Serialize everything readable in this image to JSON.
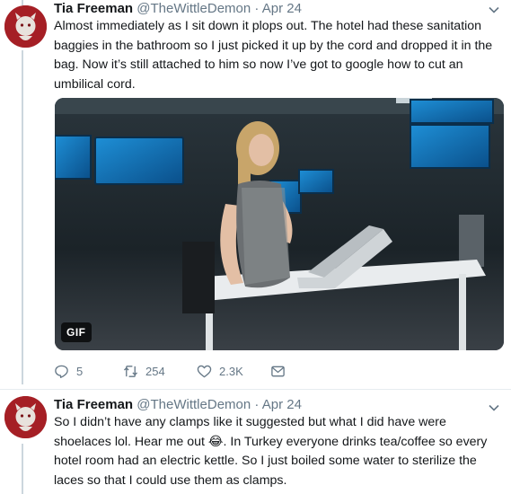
{
  "tweets": [
    {
      "author_name": "Tia Freeman",
      "handle": "@TheWittleDemon",
      "separator": "·",
      "date": "Apr 24",
      "text": "Almost immediately as I sit down it plops out. The hotel had these sanitation baggies in the bathroom so I just picked it up by the cord and dropped it in the bag. Now it’s still attached to him so now I’ve got to google how to cut an umbilical cord.",
      "media": {
        "badge": "GIF"
      },
      "actions": {
        "replies": "5",
        "retweets": "254",
        "likes": "2.3K"
      }
    },
    {
      "author_name": "Tia Freeman",
      "handle": "@TheWittleDemon",
      "separator": "·",
      "date": "Apr 24",
      "text": "So I didn’t have any clamps like it suggested but what I did have were shoelaces lol. Hear me out 😂. In Turkey everyone drinks tea/coffee so every hotel room had an electric kettle. So I just boiled some water to sterilize the laces so that I could use them as clamps."
    }
  ],
  "colors": {
    "accent": "#1da1f2",
    "muted": "#657786",
    "avatar": "#a51f25",
    "divider": "#e6ecf0"
  },
  "icons": [
    "caret-down-icon",
    "reply-icon",
    "retweet-icon",
    "like-icon",
    "dm-icon",
    "avatar-demon"
  ]
}
